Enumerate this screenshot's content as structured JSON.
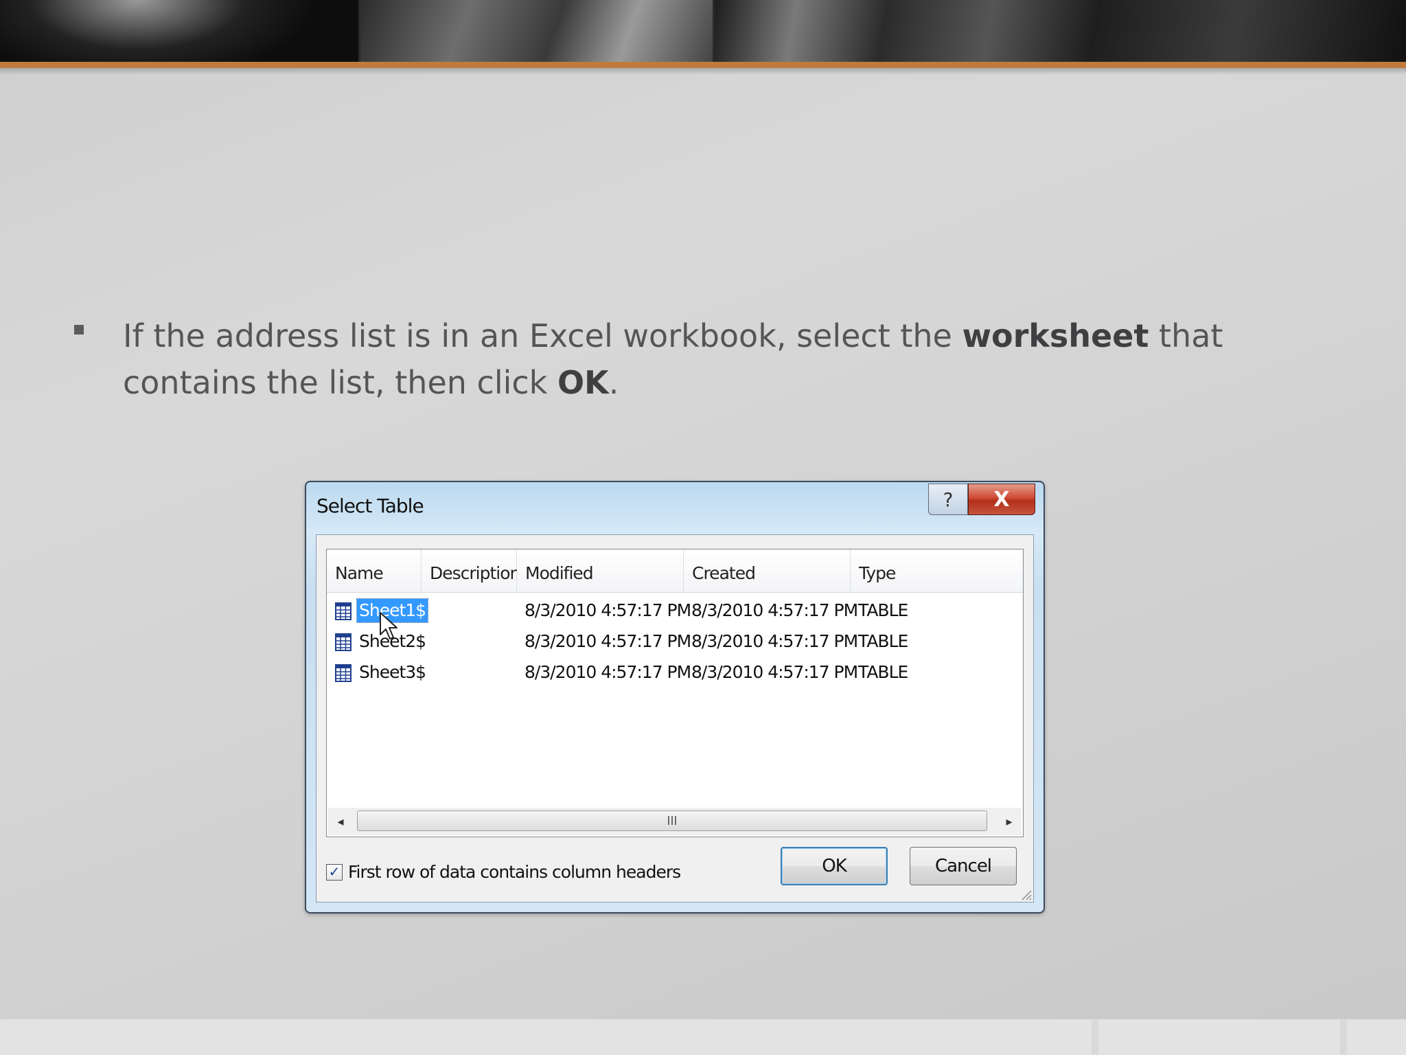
{
  "slide": {
    "bullet": {
      "part1": "If the address list is in an Excel workbook, select the ",
      "bold1": "worksheet",
      "part2": " that contains the list, then click ",
      "bold2": "OK",
      "part3": "."
    }
  },
  "dialog": {
    "title": "Select Table",
    "help_label": "?",
    "close_label": "X",
    "columns": [
      "Name",
      "Description",
      "Modified",
      "Created",
      "Type"
    ],
    "rows": [
      {
        "name": "Sheet1$",
        "description": "",
        "modified": "8/3/2010 4:57:17 PM",
        "created": "8/3/2010 4:57:17 PM",
        "type": "TABLE",
        "selected": true
      },
      {
        "name": "Sheet2$",
        "description": "",
        "modified": "8/3/2010 4:57:17 PM",
        "created": "8/3/2010 4:57:17 PM",
        "type": "TABLE",
        "selected": false
      },
      {
        "name": "Sheet3$",
        "description": "",
        "modified": "8/3/2010 4:57:17 PM",
        "created": "8/3/2010 4:57:17 PM",
        "type": "TABLE",
        "selected": false
      }
    ],
    "scroll_left": "◂",
    "scroll_thumb": "III",
    "scroll_right": "▸",
    "checkbox_label": "First row of data contains column headers",
    "checkbox_checked": true,
    "checkbox_mark": "✓",
    "ok_label": "OK",
    "cancel_label": "Cancel"
  },
  "colors": {
    "accent": "#c07a3c",
    "selection": "#3399ff",
    "close_button": "#c43d27"
  },
  "icons": {
    "row_icon": "table-icon",
    "cursor": "mouse-pointer-icon"
  }
}
